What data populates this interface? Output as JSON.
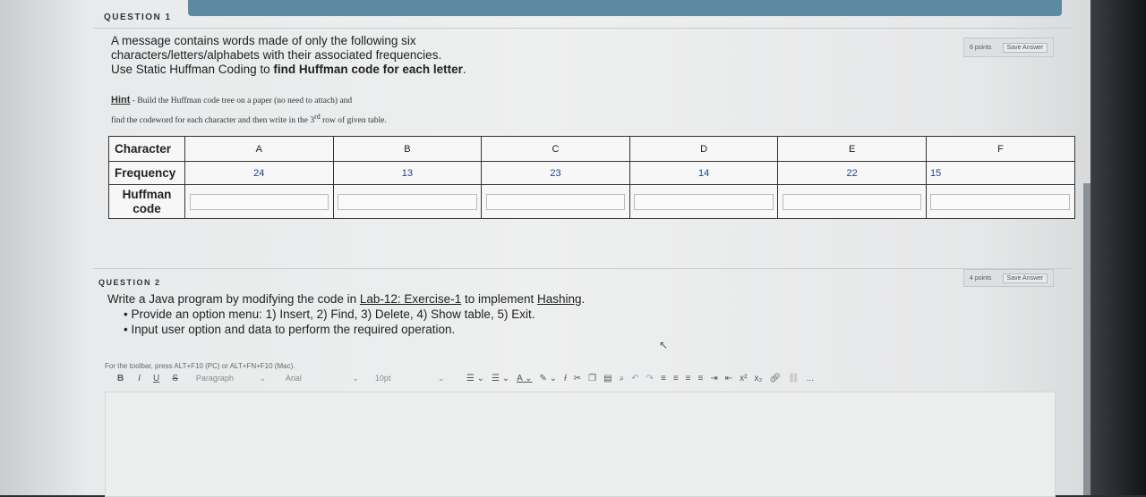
{
  "question1": {
    "label": "QUESTION 1",
    "points": "6 points",
    "save": "Save Answer",
    "line1": "A message contains words made of only the following six",
    "line2": "characters/letters/alphabets with their associated frequencies.",
    "line3_a": "Use Static Huffman Coding to ",
    "line3_b": "find Huffman code for each letter",
    "line3_c": ".",
    "hint_label": "Hint",
    "hint_line1": " - Build the Huffman code tree on a paper (no need to attach) and",
    "hint_line2_a": "find the codeword for each character and then write in the 3",
    "hint_sup": "rd",
    "hint_line2_b": " row of given table.",
    "row_labels": {
      "character": "Character",
      "frequency": "Frequency",
      "huffman1": "Huffman",
      "huffman2": "code"
    },
    "letters": [
      "A",
      "B",
      "C",
      "D",
      "E",
      "F"
    ],
    "frequencies": [
      "24",
      "13",
      "23",
      "14",
      "22",
      "15"
    ]
  },
  "question2": {
    "label": "QUESTION 2",
    "points": "4 points",
    "save": "Save Answer",
    "intro_a": "Write a Java program by modifying the code in ",
    "intro_link": "Lab-12: Exercise-1",
    "intro_b": " to implement ",
    "intro_link2": "Hashing",
    "intro_c": ".",
    "bullet1": "Provide an option menu:  1) Insert, 2) Find, 3) Delete, 4) Show table, 5) Exit.",
    "bullet2": "Input user option and data to perform the required operation."
  },
  "editor": {
    "hint": "For the toolbar, press ALT+F10 (PC) or ALT+FN+F10 (Mac).",
    "bold": "B",
    "italic": "I",
    "underline": "U",
    "strike": "S",
    "paragraph": "Paragraph",
    "font": "Arial",
    "size": "10pt",
    "superscript": "x²",
    "subscript": "x₂",
    "more": "..."
  }
}
